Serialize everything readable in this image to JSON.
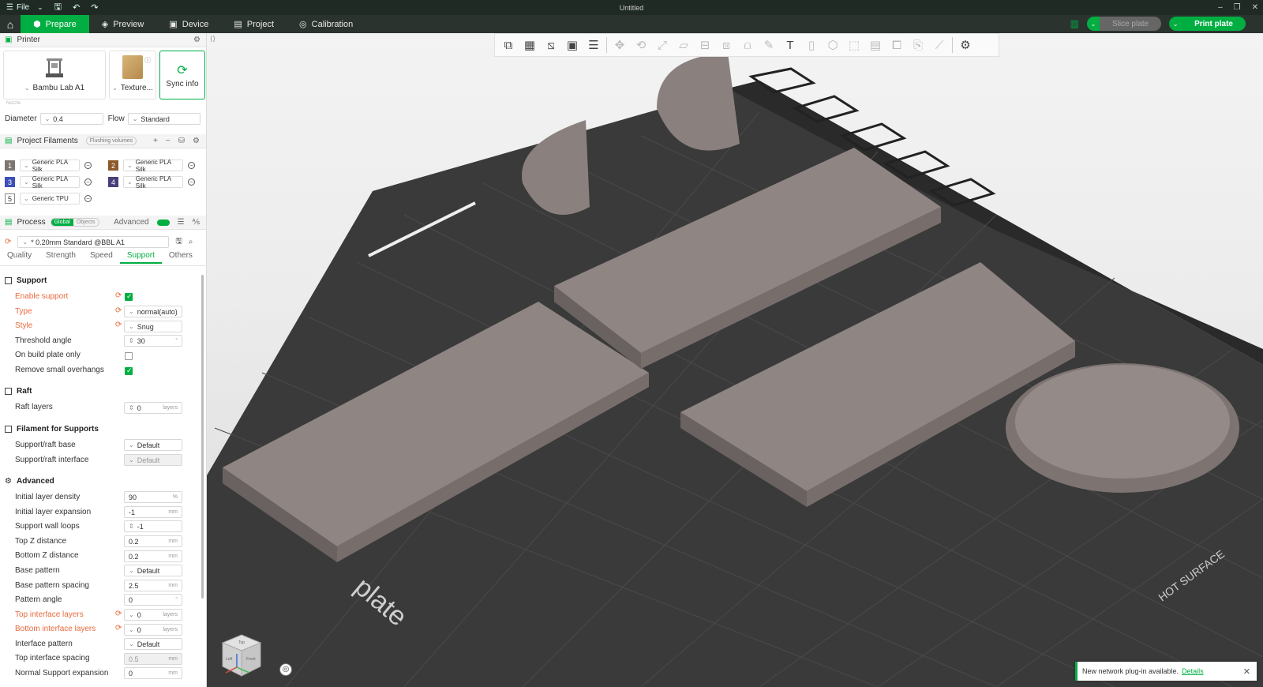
{
  "titlebar": {
    "file_label": "File",
    "title": "Untitled"
  },
  "menubar": {
    "tabs": [
      {
        "label": "Prepare",
        "icon": "cube-icon"
      },
      {
        "label": "Preview",
        "icon": "layers-icon"
      },
      {
        "label": "Device",
        "icon": "monitor-icon"
      },
      {
        "label": "Project",
        "icon": "folder-icon"
      },
      {
        "label": "Calibration",
        "icon": "target-icon"
      }
    ],
    "slice_label": "Slice plate",
    "print_label": "Print plate"
  },
  "printer": {
    "header": "Printer",
    "printer_name": "Bambu Lab A1",
    "plate_name": "Texture...",
    "sync_label": "Sync info",
    "nozzle_label": "Nozzle",
    "diameter_label": "Diameter",
    "diameter_value": "0.4",
    "flow_label": "Flow",
    "flow_value": "Standard"
  },
  "filaments": {
    "header": "Project Filaments",
    "flushing_label": "Flushing volumes",
    "items": [
      {
        "num": "1",
        "name": "Generic PLA Silk",
        "color": "#7c7570"
      },
      {
        "num": "2",
        "name": "Generic PLA Silk",
        "color": "#8b5a2b"
      },
      {
        "num": "3",
        "name": "Generic PLA Silk",
        "color": "#3d4fb8"
      },
      {
        "num": "4",
        "name": "Generic PLA Silk",
        "color": "#4a3f7a"
      },
      {
        "num": "5",
        "name": "Generic TPU",
        "color": "#ffffff"
      }
    ]
  },
  "process": {
    "header": "Process",
    "global_label": "Global",
    "objects_label": "Objects",
    "advanced_label": "Advanced",
    "preset": "* 0.20mm Standard @BBL A1",
    "tabs": [
      "Quality",
      "Strength",
      "Speed",
      "Support",
      "Others"
    ],
    "active_tab": "Support"
  },
  "support": {
    "group_support": "Support",
    "enable_support": "Enable support",
    "type_label": "Type",
    "type_value": "normal(auto)",
    "style_label": "Style",
    "style_value": "Snug",
    "threshold_label": "Threshold angle",
    "threshold_value": "30",
    "threshold_unit": "°",
    "build_plate_only": "On build plate only",
    "remove_small": "Remove small overhangs",
    "group_raft": "Raft",
    "raft_layers_label": "Raft layers",
    "raft_layers_value": "0",
    "unit_layers": "layers",
    "group_filament": "Filament for Supports",
    "raft_base_label": "Support/raft base",
    "raft_base_value": "Default",
    "raft_interface_label": "Support/raft interface",
    "raft_interface_value": "Default",
    "group_advanced": "Advanced",
    "init_density_label": "Initial layer density",
    "init_density_value": "90",
    "unit_pct": "%",
    "init_expansion_label": "Initial layer expansion",
    "init_expansion_value": "-1",
    "unit_mm": "mm",
    "wall_loops_label": "Support wall loops",
    "wall_loops_value": "-1",
    "top_z_label": "Top Z distance",
    "top_z_value": "0.2",
    "bottom_z_label": "Bottom Z distance",
    "bottom_z_value": "0.2",
    "base_pattern_label": "Base pattern",
    "base_pattern_value": "Default",
    "base_spacing_label": "Base pattern spacing",
    "base_spacing_value": "2.5",
    "pattern_angle_label": "Pattern angle",
    "pattern_angle_value": "0",
    "top_iface_label": "Top interface layers",
    "top_iface_value": "0",
    "bottom_iface_label": "Bottom interface layers",
    "bottom_iface_value": "0",
    "iface_pattern_label": "Interface pattern",
    "iface_pattern_value": "Default",
    "top_iface_spacing_label": "Top interface spacing",
    "top_iface_spacing_value": "0.5",
    "normal_expansion_label": "Normal Support expansion",
    "normal_expansion_value": "0"
  },
  "viewport": {
    "plate_text": "plate",
    "hot_surface": "HOT SURFACE",
    "cube_top": "Top",
    "cube_left": "Left",
    "cube_front": "Front"
  },
  "notification": {
    "text": "New network plug-in available.",
    "link": "Details"
  }
}
